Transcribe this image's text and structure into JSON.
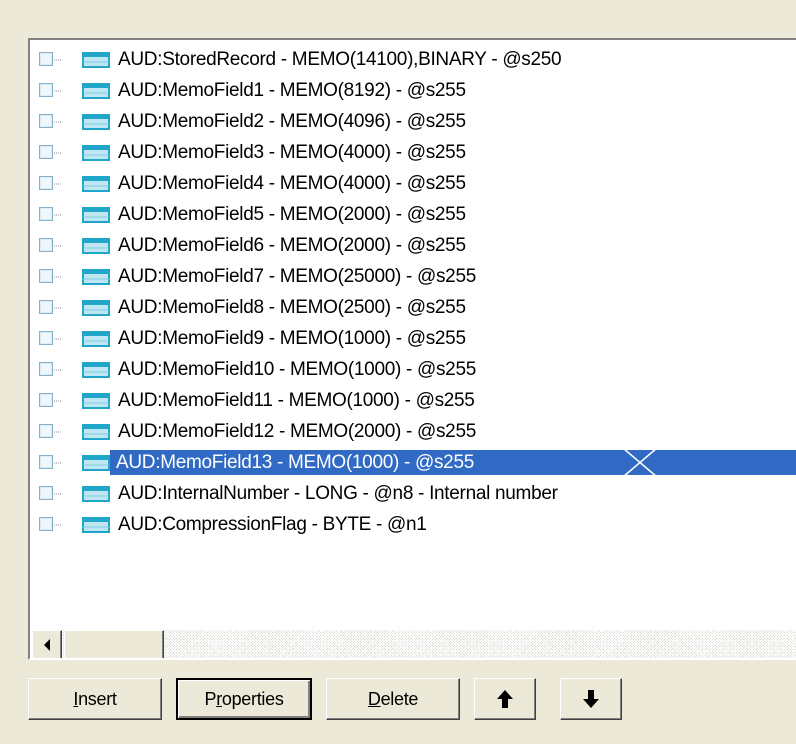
{
  "tree": {
    "items": [
      {
        "label": "AUD:StoredRecord - MEMO(14100),BINARY - @s250",
        "selected": false
      },
      {
        "label": "AUD:MemoField1 - MEMO(8192) - @s255",
        "selected": false
      },
      {
        "label": "AUD:MemoField2 - MEMO(4096) - @s255",
        "selected": false
      },
      {
        "label": "AUD:MemoField3 - MEMO(4000) - @s255",
        "selected": false
      },
      {
        "label": "AUD:MemoField4 - MEMO(4000) - @s255",
        "selected": false
      },
      {
        "label": "AUD:MemoField5 - MEMO(2000) - @s255",
        "selected": false
      },
      {
        "label": "AUD:MemoField6 - MEMO(2000) - @s255",
        "selected": false
      },
      {
        "label": "AUD:MemoField7 - MEMO(25000) - @s255",
        "selected": false
      },
      {
        "label": "AUD:MemoField8 - MEMO(2500) - @s255",
        "selected": false
      },
      {
        "label": "AUD:MemoField9 - MEMO(1000) - @s255",
        "selected": false
      },
      {
        "label": "AUD:MemoField10 - MEMO(1000) - @s255",
        "selected": false
      },
      {
        "label": "AUD:MemoField11 - MEMO(1000) - @s255",
        "selected": false
      },
      {
        "label": "AUD:MemoField12 - MEMO(2000) - @s255",
        "selected": false
      },
      {
        "label": "AUD:MemoField13 - MEMO(1000) - @s255",
        "selected": true
      },
      {
        "label": "AUD:InternalNumber - LONG - @n8 - Internal number",
        "selected": false
      },
      {
        "label": "AUD:CompressionFlag - BYTE - @n1",
        "selected": false
      }
    ]
  },
  "buttons": {
    "insert": {
      "mnemonic": "I",
      "rest": "nsert"
    },
    "properties": {
      "pre": "P",
      "mnemonic": "r",
      "rest": "operties"
    },
    "delete": {
      "mnemonic": "D",
      "rest": "elete"
    },
    "move_up_icon": "up-arrow-icon",
    "move_down_icon": "down-arrow-icon"
  },
  "colors": {
    "selection": "#316ac5",
    "face": "#ece9d8",
    "icon_teal": "#1fa6c9"
  }
}
